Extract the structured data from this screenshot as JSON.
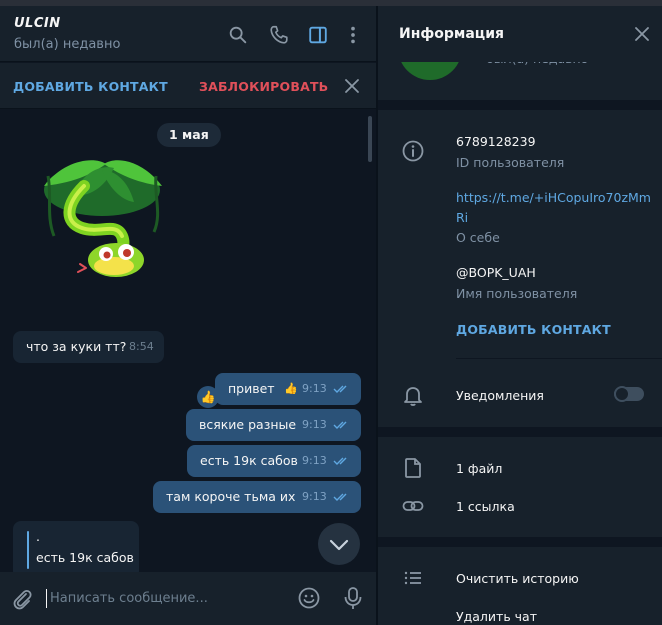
{
  "chat": {
    "name": "ULCIN",
    "status": "был(а) недавно"
  },
  "action_bar": {
    "add_contact_label": "ДОБАВИТЬ КОНТАКТ",
    "block_label": "ЗАБЛОКИРОВАТЬ"
  },
  "messages": {
    "date": "1 мая",
    "items": [
      {
        "direction": "in",
        "text": "что за куки тт?",
        "time": "8:54"
      },
      {
        "direction": "out",
        "text": "привет",
        "reaction": "👍",
        "time": "9:13"
      },
      {
        "direction": "out",
        "text": "всякие разные",
        "time": "9:13"
      },
      {
        "direction": "out",
        "text": "есть 19к сабов",
        "time": "9:13"
      },
      {
        "direction": "out",
        "text": "там короче тьма их",
        "time": "9:13"
      }
    ],
    "reply_preview": {
      "quoted": ".",
      "text": "есть 19к сабов"
    }
  },
  "composer": {
    "placeholder": "Написать сообщение..."
  },
  "info_panel": {
    "title": "Информация",
    "status": "был(а) недавно",
    "user_id": "6789128239",
    "user_id_label": "ID пользователя",
    "about_link": "https://t.me/+iHCopuIro70zMmRi",
    "about_label": "О себе",
    "username": "@BOPK_UAH",
    "username_label": "Имя пользователя",
    "add_contact_label": "ДОБАВИТЬ КОНТАКТ",
    "notifications_label": "Уведомления",
    "notifications_enabled": false,
    "files_label": "1 файл",
    "links_label": "1 ссылка",
    "clear_history_label": "Очистить историю",
    "delete_chat_label": "Удалить чат"
  },
  "colors": {
    "accent": "#5fa8e2",
    "danger": "#e0505a",
    "outgoing_bubble": "#2b5278",
    "incoming_bubble": "#182533",
    "panel_bg": "#17212b",
    "chat_bg": "#0e1621"
  },
  "icons": [
    "search-icon",
    "phone-icon",
    "sidebar-toggle-icon",
    "more-vert-icon",
    "close-icon",
    "read-ticks-icon",
    "chevron-down-icon",
    "attach-icon",
    "emoji-icon",
    "mic-icon",
    "info-icon",
    "bell-icon",
    "file-icon",
    "link-icon",
    "list-icon"
  ]
}
